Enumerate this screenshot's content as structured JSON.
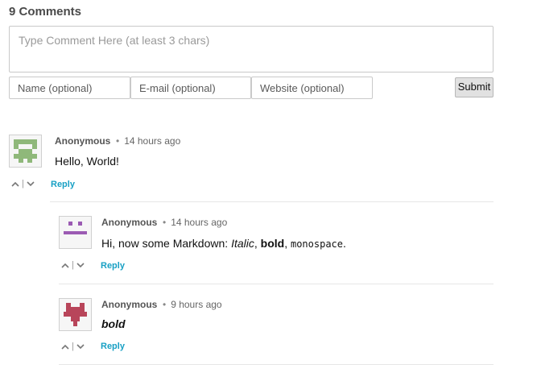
{
  "header": {
    "count_label": "9 Comments"
  },
  "form": {
    "comment_placeholder": "Type Comment Here (at least 3 chars)",
    "name_placeholder": "Name (optional)",
    "email_placeholder": "E-mail (optional)",
    "website_placeholder": "Website (optional)",
    "submit_label": "Submit"
  },
  "comments": [
    {
      "author": "Anonymous",
      "time": "14 hours ago",
      "text": "Hello, World!",
      "reply_label": "Reply",
      "avatar_color": "#8fb87a"
    },
    {
      "author": "Anonymous",
      "time": "14 hours ago",
      "text_prefix": "Hi, now some Markdown: ",
      "italic": "Italic",
      "comma1": ", ",
      "bold": "bold",
      "comma2": ", ",
      "mono": "monospace",
      "period": ".",
      "reply_label": "Reply",
      "avatar_color": "#9b5bb3"
    },
    {
      "author": "Anonymous",
      "time": "9 hours ago",
      "text_bold_italic": "bold",
      "reply_label": "Reply",
      "avatar_color": "#b8455a"
    }
  ],
  "colors": {
    "reply": "#18a0c4"
  }
}
